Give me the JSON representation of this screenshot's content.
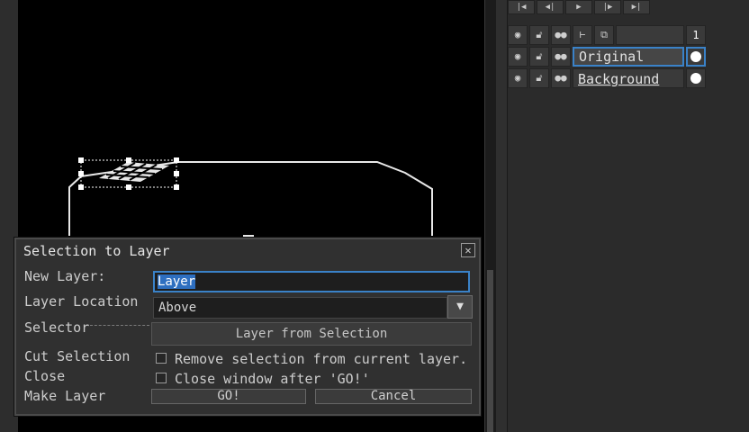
{
  "animation_controls": {
    "buttons": [
      {
        "name": "first-frame-button",
        "glyph": "|◀"
      },
      {
        "name": "prev-frame-button",
        "glyph": "◀|"
      },
      {
        "name": "play-button",
        "glyph": "▶"
      },
      {
        "name": "next-frame-button",
        "glyph": "|▶"
      },
      {
        "name": "last-frame-button",
        "glyph": "▶|"
      }
    ]
  },
  "layers_panel": {
    "header": {
      "icons": [
        "eye-icon",
        "lock-icon",
        "link-icon",
        "tree-icon",
        "duplicate-icon"
      ],
      "frame_number": "1"
    },
    "layers": [
      {
        "name": "Original",
        "selected": true,
        "icons": [
          "eye-icon",
          "lock-icon",
          "link-icon"
        ]
      },
      {
        "name": "Background",
        "selected": false,
        "icons": [
          "eye-icon",
          "lock-icon",
          "link-icon"
        ]
      }
    ]
  },
  "dialog": {
    "title": "Selection to Layer",
    "close_glyph": "✕",
    "labels": {
      "new_layer": "New Layer:",
      "layer_location": "Layer Location",
      "selector": "Selector",
      "cut_selection": "Cut Selection",
      "close": "Close",
      "make_layer": "Make Layer"
    },
    "new_layer_value": "Layer",
    "layer_location_value": "Above",
    "dropdown_arrow": "▼",
    "layer_from_selection_label": "Layer from Selection",
    "remove_selection_label": "Remove selection from current layer.",
    "remove_selection_checked": false,
    "close_window_label": "Close window after 'GO!'",
    "close_window_checked": false,
    "go_label": "GO!",
    "cancel_label": "Cancel"
  },
  "colors": {
    "accent": "#3a82c8",
    "canvas_bg": "#000000",
    "panel_bg": "#2b2b2b",
    "dialog_bg": "#303030"
  }
}
